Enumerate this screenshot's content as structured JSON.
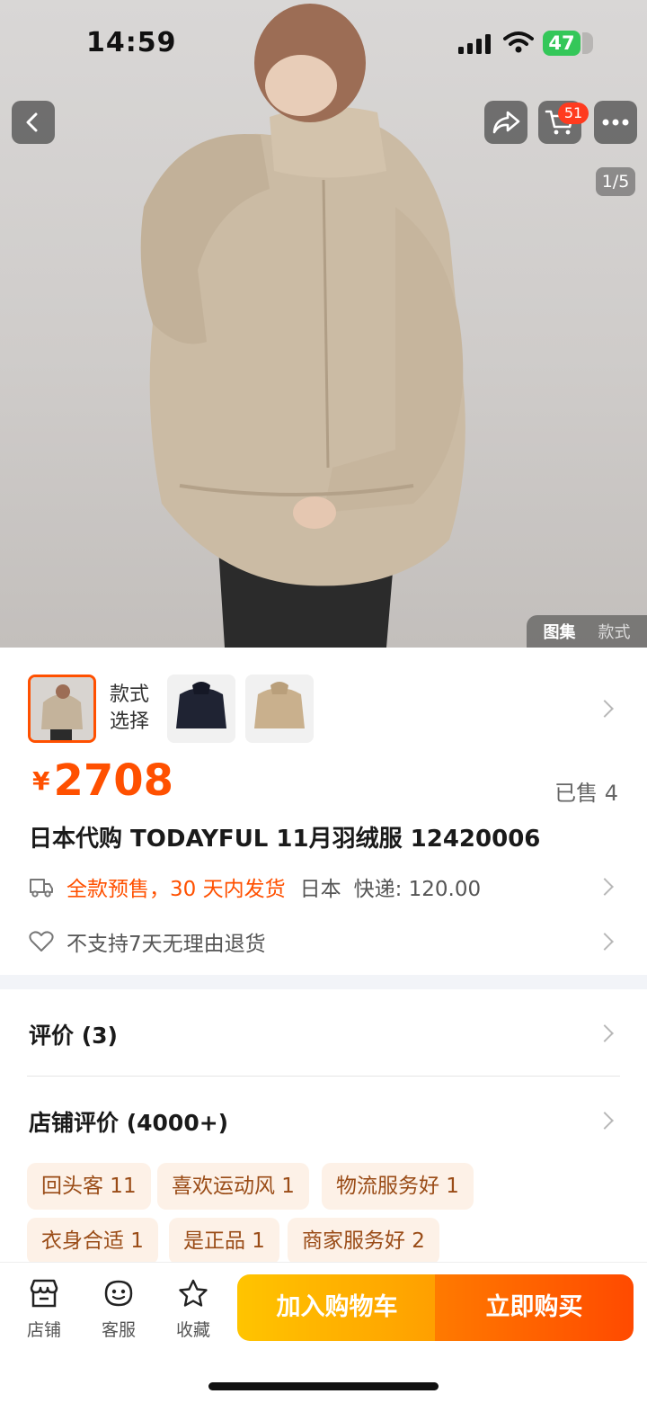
{
  "status": {
    "time": "14:59",
    "battery": "47"
  },
  "nav": {
    "cart_badge": "51",
    "pager": "1/5",
    "gallery_tabs": [
      "图集",
      "款式"
    ]
  },
  "variants": {
    "label": "款式\n选择",
    "label_line1": "款式",
    "label_line2": "选择"
  },
  "product": {
    "currency": "¥",
    "price": "2708",
    "sold": "已售 4",
    "title": "日本代购 TODAYFUL 11月羽绒服 12420006",
    "presale": "全款预售，30 天内发货",
    "origin": "日本",
    "shipping": "快递: 120.00",
    "returns": "不支持7天无理由退货"
  },
  "reviews": {
    "label": "评价 (3)",
    "shop_label": "店铺评价 (4000+)",
    "tags": [
      "回头客 11",
      "喜欢运动风 1",
      "物流服务好 1",
      "衣身合适 1",
      "是正品 1",
      "商家服务好 2"
    ]
  },
  "bottombar": {
    "shop": "店铺",
    "service": "客服",
    "favorite": "收藏",
    "add_cart": "加入购物车",
    "buy_now": "立即购买"
  },
  "colors": {
    "accent": "#ff5000",
    "tag_bg": "#fdf1e7",
    "tag_text": "#9a4c17"
  }
}
